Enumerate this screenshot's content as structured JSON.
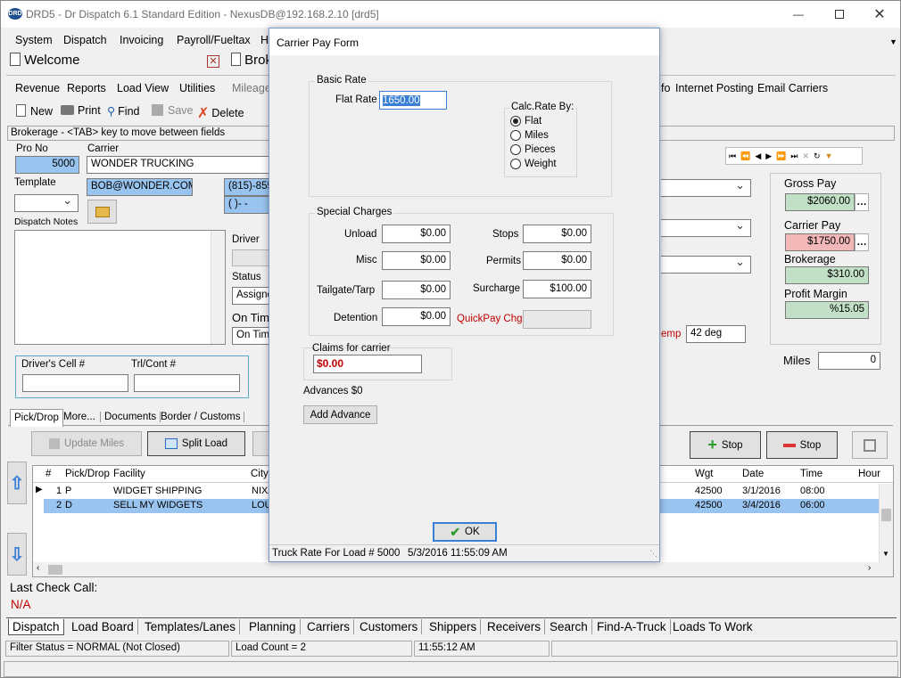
{
  "titlebar": {
    "title": "DRD5 - Dr Dispatch 6.1 Standard Edition - NexusDB@192.168.2.10 [drd5]",
    "logo": "DRD"
  },
  "menu": [
    "System",
    "Dispatch",
    "Invoicing",
    "Payroll/Fueltax",
    "H"
  ],
  "tabs": {
    "welcome": "Welcome",
    "brok": "Brok"
  },
  "toolbar1": {
    "revenue": "Revenue",
    "reports": "Reports",
    "loadview": "Load View",
    "utilities": "Utilities",
    "mileage": "Mileage",
    "fo": "fo",
    "internet": "Internet Posting",
    "email": "Email Carriers"
  },
  "toolbar2": {
    "new": "New",
    "print": "Print",
    "find": "Find",
    "save": "Save",
    "delete": "Delete"
  },
  "hint": "Brokerage - <TAB> key to move between fields",
  "load": {
    "pro_no_label": "Pro No",
    "pro_no": "5000",
    "carrier_label": "Carrier",
    "carrier": "WONDER TRUCKING",
    "template_label": "Template",
    "email": "BOB@WONDER.COM",
    "phone": "(815)-855",
    "phone2": "(  )-  -",
    "notes_label": "Dispatch Notes",
    "driver_label": "Driver",
    "status_label": "Status",
    "status": "Assigned",
    "ontime_label": "On Tim",
    "ontime": "On Time",
    "driver_cell_label": "Driver's Cell #",
    "trl_label": "Trl/Cont #",
    "temp_label": "emp",
    "temp": "42 deg",
    "miles_label": "Miles",
    "miles": "0"
  },
  "pay": {
    "gross_label": "Gross Pay",
    "gross": "$2060.00",
    "carrier_label": "Carrier Pay",
    "carrier": "$1750.00",
    "brokerage_label": "Brokerage",
    "brokerage": "$310.00",
    "margin_label": "Profit Margin",
    "margin": "%15.05",
    "dots": "…"
  },
  "subtabs": [
    "Pick/Drop",
    "More...",
    "Documents",
    "Border / Customs"
  ],
  "buttons": {
    "update_miles": "Update Miles",
    "split_load": "Split Load",
    "add_stop": "Stop",
    "del_stop": "Stop"
  },
  "grid": {
    "columns": [
      "#",
      "Pick/Drop",
      "Facility",
      "City",
      "Wgt",
      "Date",
      "Time",
      "Hour"
    ],
    "rows": [
      {
        "n": "1",
        "pd": "P",
        "facility": "WIDGET SHIPPING",
        "city": "NIXA",
        "wgt": "42500",
        "date": "3/1/2016",
        "time": "08:00"
      },
      {
        "n": "2",
        "pd": "D",
        "facility": "SELL MY WIDGETS",
        "city": "LOU",
        "wgt": "42500",
        "date": "3/4/2016",
        "time": "06:00"
      }
    ]
  },
  "last_check": {
    "label": "Last Check Call:",
    "value": "N/A"
  },
  "bottom_tabs": [
    "Dispatch",
    "Load Board",
    "Templates/Lanes",
    "Planning",
    "Carriers",
    "Customers",
    "Shippers",
    "Receivers",
    "Search",
    "Find-A-Truck",
    "Loads To Work"
  ],
  "status": {
    "filter": "Filter Status = NORMAL (Not Closed)",
    "count": "Load Count = 2",
    "time": "11:55:12 AM"
  },
  "dialog": {
    "title": "Carrier Pay Form",
    "basic_rate": "Basic Rate",
    "flat_rate_label": "Flat Rate",
    "flat_rate": "1650.00",
    "calc_label": "Calc.Rate By:",
    "calc_options": [
      "Flat",
      "Miles",
      "Pieces",
      "Weight"
    ],
    "calc_selected": "Flat",
    "special": "Special Charges",
    "unload_label": "Unload",
    "unload": "$0.00",
    "stops_label": "Stops",
    "stops": "$0.00",
    "misc_label": "Misc",
    "misc": "$0.00",
    "permits_label": "Permits",
    "permits": "$0.00",
    "tailgate_label": "Tailgate/Tarp",
    "tailgate": "$0.00",
    "surcharge_label": "Surcharge",
    "surcharge": "$100.00",
    "detention_label": "Detention",
    "detention": "$0.00",
    "quickpay_label": "QuickPay Chg",
    "quickpay": "",
    "claims_label": "Claims for carrier",
    "claims": "$0.00",
    "advances": "Advances $0",
    "add_advance": "Add Advance",
    "ok": "OK",
    "footer_rate": "Truck Rate For Load # 5000",
    "footer_time": "5/3/2016 11:55:09 AM"
  },
  "colors": {
    "blue_field": "#99c4ef",
    "green_field": "#c2e0c6",
    "red_field": "#f2b8b8",
    "selection": "#99c4ef",
    "quickpay": "#c00000"
  }
}
